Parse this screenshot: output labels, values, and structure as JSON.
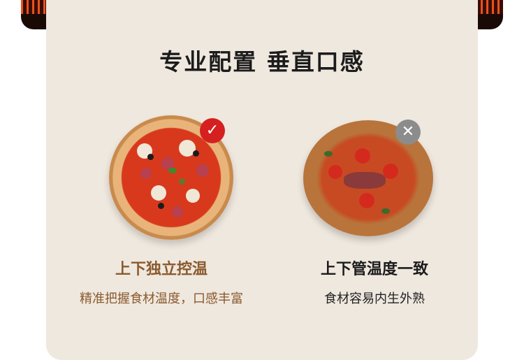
{
  "headline": "专业配置 垂直口感",
  "left": {
    "title": "上下独立控温",
    "desc": "精准把握食材温度，口感丰富",
    "badge": "check-icon",
    "badge_color": "#d62020"
  },
  "right": {
    "title": "上下管温度一致",
    "desc": "食材容易内生外熟",
    "badge": "cross-icon",
    "badge_color": "#8c8c8c"
  },
  "colors": {
    "card_bg": "#efe8df",
    "accent_text": "#8a5a2e",
    "dark_text": "#1c1c1c"
  }
}
